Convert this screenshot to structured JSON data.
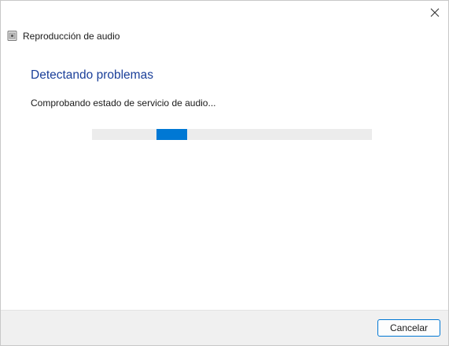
{
  "window": {
    "title": "Reproducción de audio"
  },
  "main": {
    "heading": "Detectando problemas",
    "status": "Comprobando estado de servicio de audio..."
  },
  "progress": {
    "mode": "indeterminate"
  },
  "footer": {
    "cancel_label": "Cancelar"
  },
  "colors": {
    "accent": "#0078d4",
    "heading": "#1a3f99",
    "track": "#ececec",
    "footer_bg": "#f0f0f0"
  },
  "icons": {
    "close": "close-icon",
    "app": "audio-troubleshooter-icon"
  }
}
